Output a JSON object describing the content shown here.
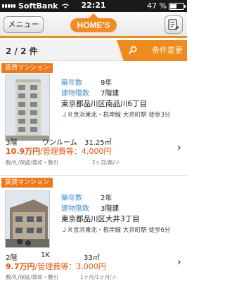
{
  "status": {
    "carrier": "SoftBank",
    "time": "22:21",
    "battery": "47 %"
  },
  "nav": {
    "menu_label": "メニュー",
    "logo": "HOME'S"
  },
  "results": {
    "count": "2 / 2 件",
    "condition_button": "条件変更"
  },
  "listings": [
    {
      "badge": "賃貸マンション",
      "age_label": "築年数",
      "age": "9年",
      "floors_label": "建物階数",
      "floors": "7階建",
      "address": "東京都品川区南品川6丁目",
      "station": "ＪＲ京浜東北・根岸線 大井町駅 徒歩3分",
      "floor": "3階",
      "layout": "ワンルーム",
      "area": "31.25㎡",
      "rent": "10.9万円",
      "mgmt": "/管理費等：4,000円",
      "terms": "敷/礼/保証/償却・敷引",
      "terms_value": "2ヶ月/無/-/-"
    },
    {
      "badge": "賃貸マンション",
      "age_label": "築年数",
      "age": "2年",
      "floors_label": "建物階数",
      "floors": "3階建",
      "address": "東京都品川区大井3丁目",
      "station": "ＪＲ京浜東北・根岸線 大井町駅 徒歩6分",
      "floor": "2階",
      "layout": "1K",
      "area": "33㎡",
      "rent": "9.7万円",
      "mgmt": "/管理費等：3,000円",
      "terms": "敷/礼/保証/償却・敷引",
      "terms_value": "1ヶ月/1ヶ月/-/-"
    }
  ],
  "colors": {
    "accent": "#f28a1b",
    "rent": "#e8550d",
    "label": "#3f8ec9"
  }
}
